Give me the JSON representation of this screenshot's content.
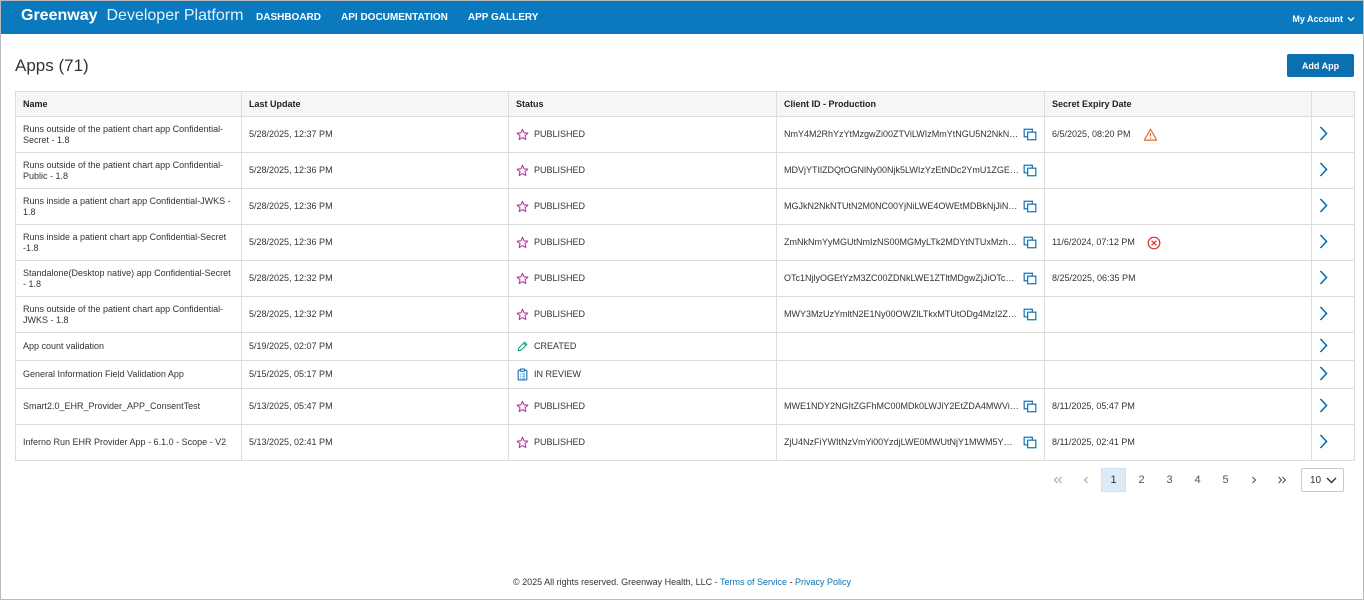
{
  "header": {
    "brand_bold": "Greenway",
    "brand_light": "Developer Platform",
    "nav": [
      "DASHBOARD",
      "API DOCUMENTATION",
      "APP GALLERY"
    ],
    "account": "My Account"
  },
  "main": {
    "title": "Apps (71)",
    "add_button": "Add App"
  },
  "table": {
    "columns": [
      "Name",
      "Last Update",
      "Status",
      "Client ID - Production",
      "Secret Expiry Date",
      ""
    ],
    "rows": [
      {
        "name": "Runs outside of the patient chart app Confidential-Secret - 1.8",
        "updated": "5/28/2025, 12:37 PM",
        "status": "PUBLISHED",
        "status_icon": "star-icon",
        "client_id": "NmY4M2RhYzYtMzgwZi00ZTViLWIzMmYtNGU5N2NkN…",
        "expiry": "6/5/2025, 08:20 PM",
        "expiry_icon": "warning-icon"
      },
      {
        "name": "Runs outside of the patient chart app Confidential-Public - 1.8",
        "updated": "5/28/2025, 12:36 PM",
        "status": "PUBLISHED",
        "status_icon": "star-icon",
        "client_id": "MDVjYTIlZDQtOGNlNy00Njk5LWIzYzEtNDc2YmU1ZGE5…",
        "expiry": "",
        "expiry_icon": ""
      },
      {
        "name": "Runs inside a patient chart app Confidential-JWKS - 1.8",
        "updated": "5/28/2025, 12:36 PM",
        "status": "PUBLISHED",
        "status_icon": "star-icon",
        "client_id": "MGJkN2NkNTUtN2M0NC00YjNiLWE4OWEtMDBkNjJiN…",
        "expiry": "",
        "expiry_icon": ""
      },
      {
        "name": "Runs inside a patient chart app Confidential-Secret -1.8",
        "updated": "5/28/2025, 12:36 PM",
        "status": "PUBLISHED",
        "status_icon": "star-icon",
        "client_id": "ZmNkNmYyMGUtNmIzNS00MGMyLTk2MDYtNTUxMzh…",
        "expiry": "11/6/2024, 07:12 PM",
        "expiry_icon": "error-circle-icon"
      },
      {
        "name": "Standalone(Desktop native) app Confidential-Secret - 1.8",
        "updated": "5/28/2025, 12:32 PM",
        "status": "PUBLISHED",
        "status_icon": "star-icon",
        "client_id": "OTc1NjlyOGEtYzM3ZC00ZDNkLWE1ZTltMDgwZjJiOTc1…",
        "expiry": "8/25/2025, 06:35 PM",
        "expiry_icon": ""
      },
      {
        "name": "Runs outside of the patient chart app Confidential-JWKS - 1.8",
        "updated": "5/28/2025, 12:32 PM",
        "status": "PUBLISHED",
        "status_icon": "star-icon",
        "client_id": "MWY3MzUzYmltN2E1Ny00OWZlLTkxMTUtODg4MzI2Z…",
        "expiry": "",
        "expiry_icon": ""
      },
      {
        "name": "App count validation",
        "updated": "5/19/2025, 02:07 PM",
        "status": "CREATED",
        "status_icon": "pencil-icon",
        "client_id": "",
        "expiry": "",
        "expiry_icon": ""
      },
      {
        "name": "General Information Field Validation App",
        "updated": "5/15/2025, 05:17 PM",
        "status": "IN REVIEW",
        "status_icon": "clipboard-icon",
        "client_id": "",
        "expiry": "",
        "expiry_icon": ""
      },
      {
        "name": "Smart2.0_EHR_Provider_APP_ConsentTest",
        "updated": "5/13/2025, 05:47 PM",
        "status": "PUBLISHED",
        "status_icon": "star-icon",
        "client_id": "MWE1NDY2NGItZGFhMC00MDk0LWJlY2EtZDA4MWVi…",
        "expiry": "8/11/2025, 05:47 PM",
        "expiry_icon": ""
      },
      {
        "name": "Inferno Run EHR Provider App - 6.1.0 - Scope - V2",
        "updated": "5/13/2025, 02:41 PM",
        "status": "PUBLISHED",
        "status_icon": "star-icon",
        "client_id": "ZjU4NzFiYWItNzVmYi00YzdjLWE0MWUtNjY1MWM5Y…",
        "expiry": "8/11/2025, 02:41 PM",
        "expiry_icon": ""
      }
    ]
  },
  "pagination": {
    "pages": [
      "1",
      "2",
      "3",
      "4",
      "5"
    ],
    "current": "1",
    "page_size": "10"
  },
  "footer": {
    "text": "© 2025 All rights reserved. Greenway Health, LLC - ",
    "tos": "Terms of Service",
    "sep": " - ",
    "privacy": "Privacy Policy"
  },
  "colors": {
    "header_bg": "#0b79bd",
    "primary_button": "#0b6fb0",
    "published_star": "#b4369f",
    "created_pencil": "#1e9a83",
    "review_clipboard": "#0b6fb0",
    "warning": "#e46b2b",
    "error": "#d62d2d",
    "chevron": "#0b6fb0"
  }
}
